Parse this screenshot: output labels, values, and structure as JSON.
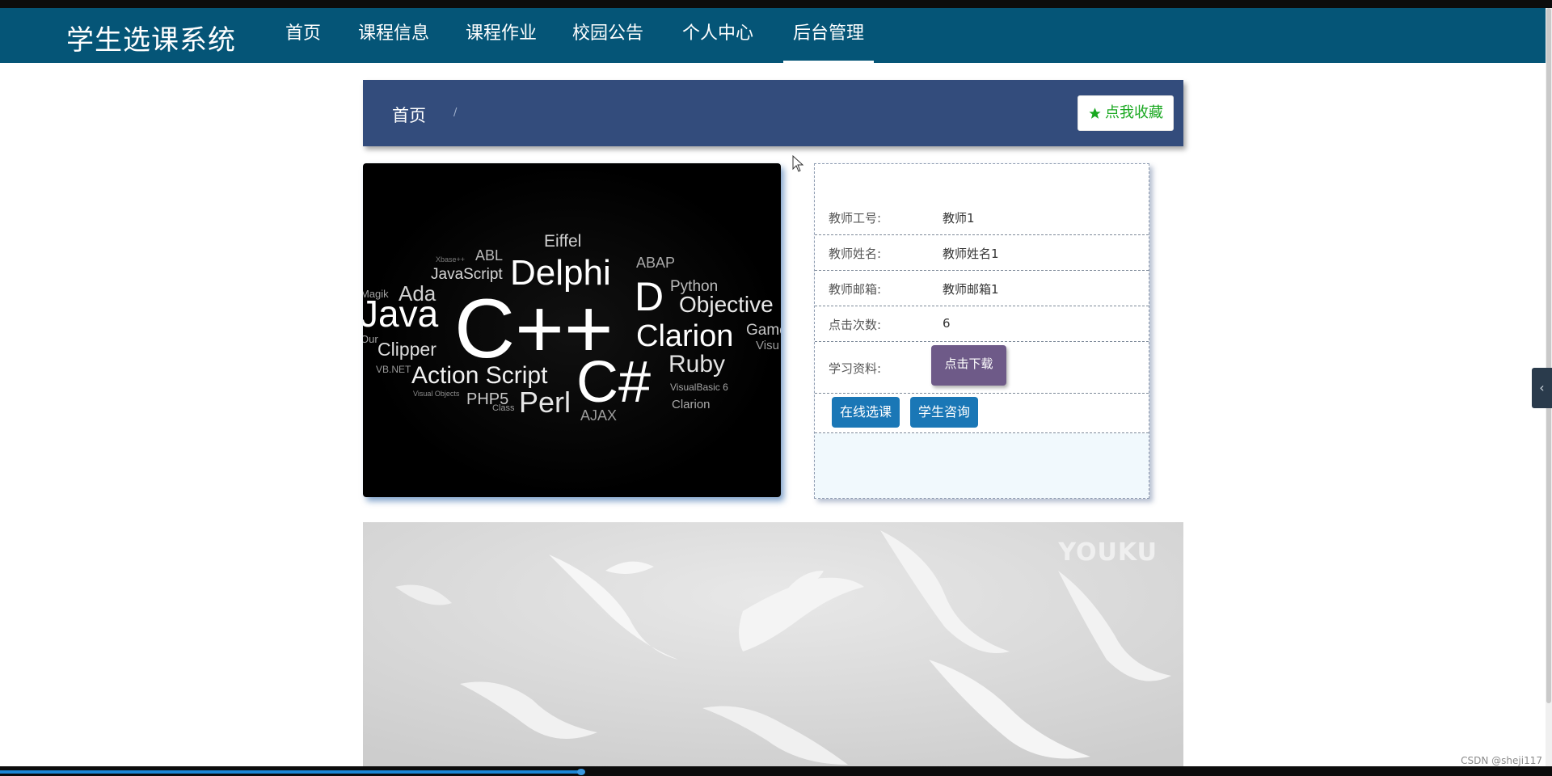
{
  "app": {
    "brand": "学生选课系统"
  },
  "nav": {
    "items": [
      {
        "label": "首页"
      },
      {
        "label": "课程信息"
      },
      {
        "label": "课程作业"
      },
      {
        "label": "校园公告"
      },
      {
        "label": "个人中心"
      },
      {
        "label": "后台管理"
      }
    ],
    "active_index": 5
  },
  "breadcrumb": {
    "home": "首页",
    "separator": "/"
  },
  "favorite": {
    "label": "点我收藏",
    "icon": "star-icon",
    "color": "#19a820"
  },
  "course_image": {
    "words": [
      "Eiffel",
      "ABL",
      "JavaScript",
      "Delphi",
      "ABAP",
      "Python",
      "Ada",
      "Java",
      "C++",
      "D",
      "Objective",
      "Clarion",
      "Game",
      "Clipper",
      "Visu",
      "VB.NET",
      "Action Script",
      "C#",
      "Ruby",
      "VisualBasic 6",
      "PHP5",
      "Perl",
      "Visual Objects",
      "Class",
      "AJAX",
      "Magik",
      "Our",
      "Xbase++"
    ]
  },
  "teacher": {
    "fields": [
      {
        "label": "教师工号:",
        "value": "教师1"
      },
      {
        "label": "教师姓名:",
        "value": "教师姓名1"
      },
      {
        "label": "教师邮箱:",
        "value": "教师邮箱1"
      },
      {
        "label": "点击次数:",
        "value": "6"
      }
    ],
    "material_label": "学习资料:",
    "download_label": "点击下载"
  },
  "actions": {
    "select_label": "在线选课",
    "consult_label": "学生咨询"
  },
  "video": {
    "logo": "YOUKU"
  },
  "watermark": "CSDN @sheji117",
  "side_toggle": {
    "icon": "chevron-left-icon"
  },
  "colors": {
    "navbar": "#055577",
    "breadcrumb_bar": "#334c7c",
    "download_button": "#6e5a88",
    "action_button": "#1a77b6"
  }
}
